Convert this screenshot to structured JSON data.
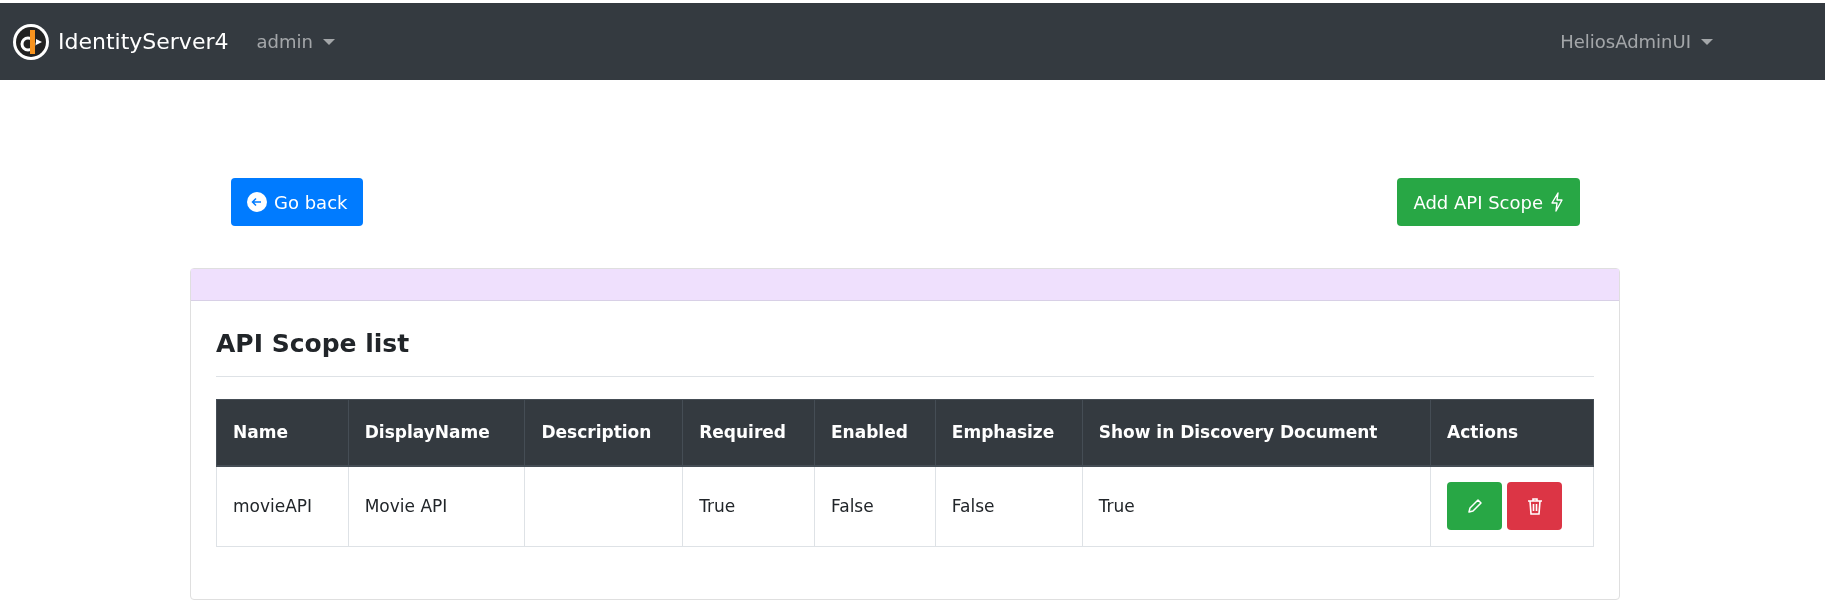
{
  "navbar": {
    "brand": "IdentityServer4",
    "menus": [
      {
        "label": "admin"
      }
    ],
    "user_menu": {
      "label": "HeliosAdminUI"
    }
  },
  "actions": {
    "back": "Go back",
    "add": "Add API Scope"
  },
  "card": {
    "title": "API Scope list"
  },
  "table": {
    "columns": [
      "Name",
      "DisplayName",
      "Description",
      "Required",
      "Enabled",
      "Emphasize",
      "Show in Discovery Document",
      "Actions"
    ],
    "rows": [
      {
        "cells": [
          "movieAPI",
          "Movie API",
          "",
          "True",
          "False",
          "False",
          "True"
        ]
      }
    ]
  }
}
